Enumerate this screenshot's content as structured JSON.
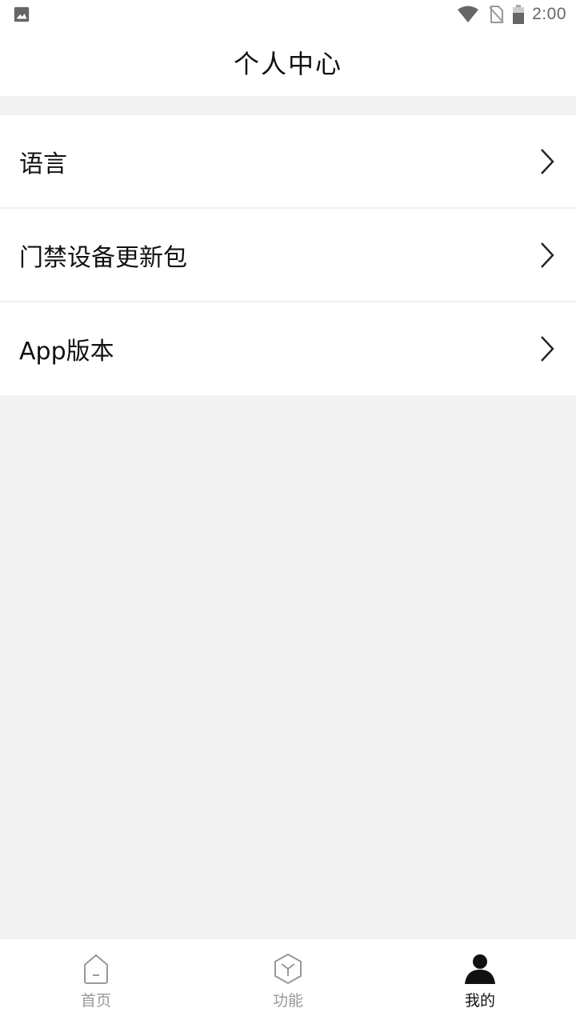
{
  "status_bar": {
    "time": "2:00",
    "icons": [
      "image-icon",
      "wifi-icon",
      "no-sim-icon",
      "battery-icon"
    ]
  },
  "header": {
    "title": "个人中心"
  },
  "menu": {
    "items": [
      {
        "label": "语言",
        "icon": "chevron-right-icon"
      },
      {
        "label": "门禁设备更新包",
        "icon": "chevron-right-icon"
      },
      {
        "label": "App版本",
        "icon": "chevron-right-icon"
      }
    ]
  },
  "tab_bar": {
    "tabs": [
      {
        "label": "首页",
        "icon": "home-icon",
        "active": false
      },
      {
        "label": "功能",
        "icon": "cube-icon",
        "active": false
      },
      {
        "label": "我的",
        "icon": "user-icon",
        "active": true
      }
    ]
  },
  "colors": {
    "background": "#f2f2f2",
    "surface": "#ffffff",
    "text_primary": "#111111",
    "text_inactive": "#999999",
    "divider": "#efefef"
  }
}
